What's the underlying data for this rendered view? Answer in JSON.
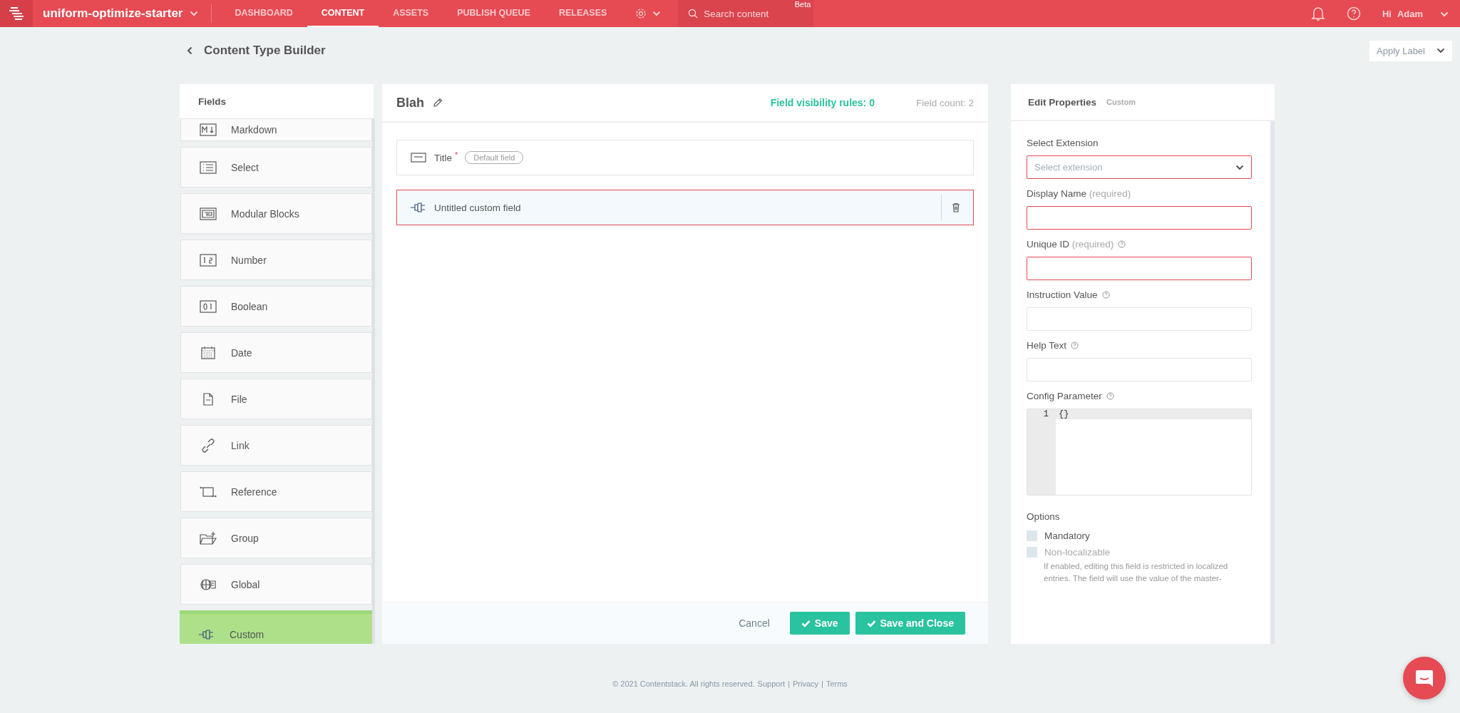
{
  "topbar": {
    "stack": "uniform-optimize-starter",
    "nav": [
      {
        "label": "DASHBOARD",
        "selected": false
      },
      {
        "label": "CONTENT",
        "selected": true
      },
      {
        "label": "ASSETS",
        "selected": false
      },
      {
        "label": "PUBLISH QUEUE",
        "selected": false
      },
      {
        "label": "RELEASES",
        "selected": false
      }
    ],
    "search": {
      "placeholder": "Search content",
      "badge": "Beta"
    },
    "greeting": "Hi",
    "user": "Adam"
  },
  "page": {
    "title": "Content Type Builder",
    "apply_label": "Apply Label"
  },
  "fields_panel": {
    "title": "Fields",
    "items": [
      {
        "label": "Markdown",
        "kind": "markdown",
        "selected": false
      },
      {
        "label": "Select",
        "kind": "select",
        "selected": false
      },
      {
        "label": "Modular Blocks",
        "kind": "blocks",
        "selected": false
      },
      {
        "label": "Number",
        "kind": "number",
        "selected": false
      },
      {
        "label": "Boolean",
        "kind": "boolean",
        "selected": false
      },
      {
        "label": "Date",
        "kind": "date",
        "selected": false
      },
      {
        "label": "File",
        "kind": "file",
        "selected": false
      },
      {
        "label": "Link",
        "kind": "link",
        "selected": false
      },
      {
        "label": "Reference",
        "kind": "reference",
        "selected": false
      },
      {
        "label": "Group",
        "kind": "group",
        "selected": false
      },
      {
        "label": "Global",
        "kind": "global",
        "selected": false
      },
      {
        "label": "Custom",
        "kind": "custom",
        "selected": true
      }
    ]
  },
  "builder": {
    "name": "Blah",
    "visibility_rules": "Field visibility rules: 0",
    "field_count": "Field count: 2",
    "rows": [
      {
        "label": "Title",
        "kind": "title",
        "required_mark": "*",
        "badge": "Default field",
        "selected": false
      },
      {
        "label": "Untitled custom field",
        "kind": "custom",
        "selected": true
      }
    ],
    "cancel": "Cancel",
    "save": "Save",
    "save_close": "Save and Close"
  },
  "properties": {
    "title": "Edit Properties",
    "subtitle": "Custom",
    "fields": [
      {
        "label": "Select Extension",
        "kind": "select",
        "placeholder": "Select extension",
        "invalid": true
      },
      {
        "label": "Display Name",
        "note": "(required)",
        "kind": "text",
        "invalid": true
      },
      {
        "label": "Unique ID",
        "note": "(required)",
        "help": true,
        "kind": "text",
        "invalid": true
      },
      {
        "label": "Instruction Value",
        "help": true,
        "kind": "text",
        "invalid": false
      },
      {
        "label": "Help Text",
        "help": true,
        "kind": "text",
        "invalid": false
      },
      {
        "label": "Config Parameter",
        "help": true,
        "kind": "code",
        "line": "1",
        "code": "{}"
      }
    ],
    "options_title": "Options",
    "options": [
      {
        "label": "Mandatory",
        "checked": false,
        "disabled": false
      },
      {
        "label": "Non-localizable",
        "checked": false,
        "disabled": true,
        "description": "If enabled, editing this field is restricted in localized entries. The field will use the value of the master-"
      }
    ]
  },
  "footer": {
    "text": "© 2021 Contentstack. All rights reserved.",
    "links": [
      "Support",
      "Privacy",
      "Terms"
    ],
    "separators": [
      "|",
      "|"
    ]
  }
}
